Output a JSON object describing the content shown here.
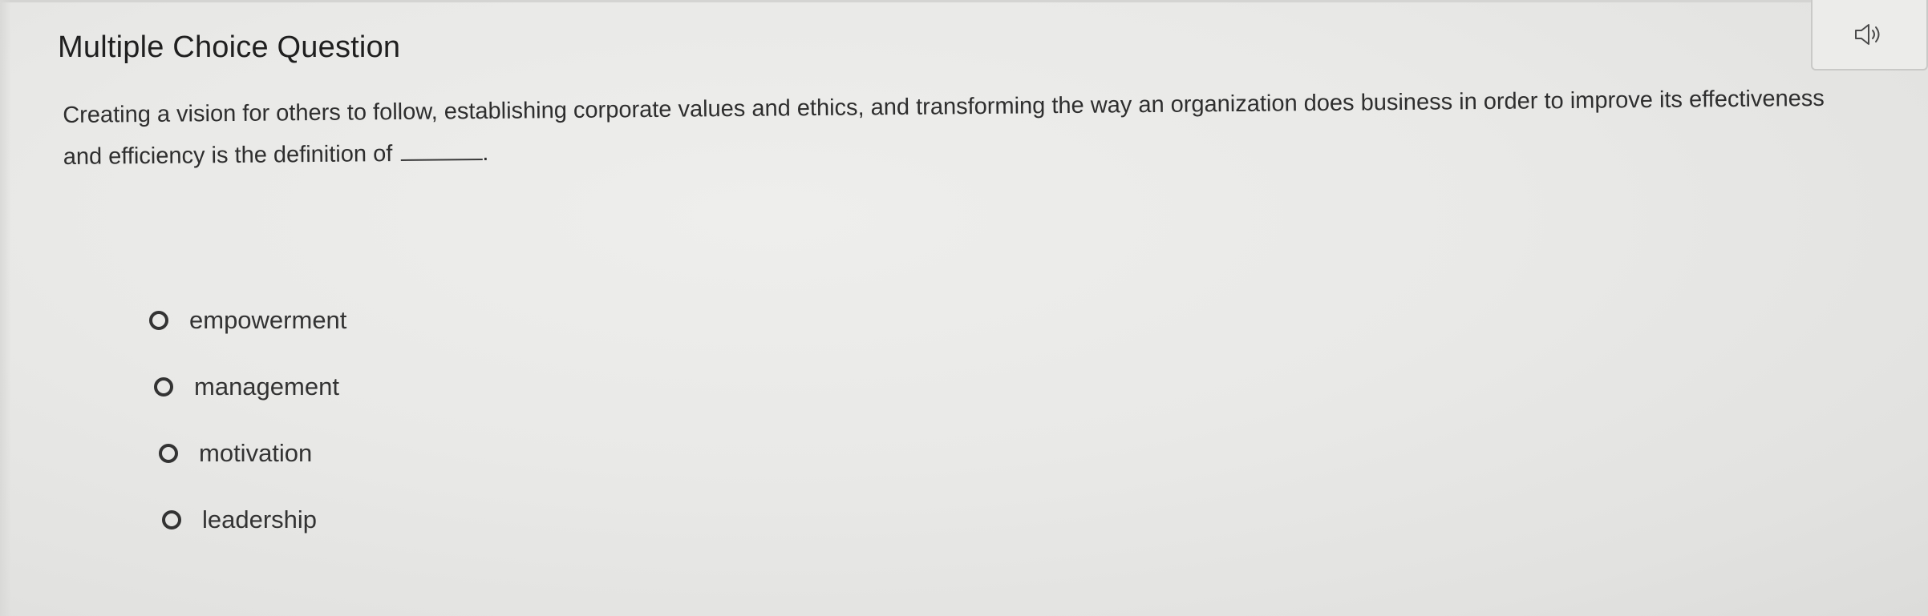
{
  "header": {
    "title": "Multiple Choice Question",
    "audio_icon": "speaker-icon"
  },
  "question": {
    "text": "Creating a vision for others to follow, establishing corporate values and ethics, and transforming the way an organization does business in order to improve its effectiveness and efficiency is the definition of",
    "suffix": "."
  },
  "choices": [
    {
      "label": "empowerment"
    },
    {
      "label": "management"
    },
    {
      "label": "motivation"
    },
    {
      "label": "leadership"
    }
  ],
  "colors": {
    "background": "#e9e9e7",
    "text": "#2b2b2b"
  }
}
